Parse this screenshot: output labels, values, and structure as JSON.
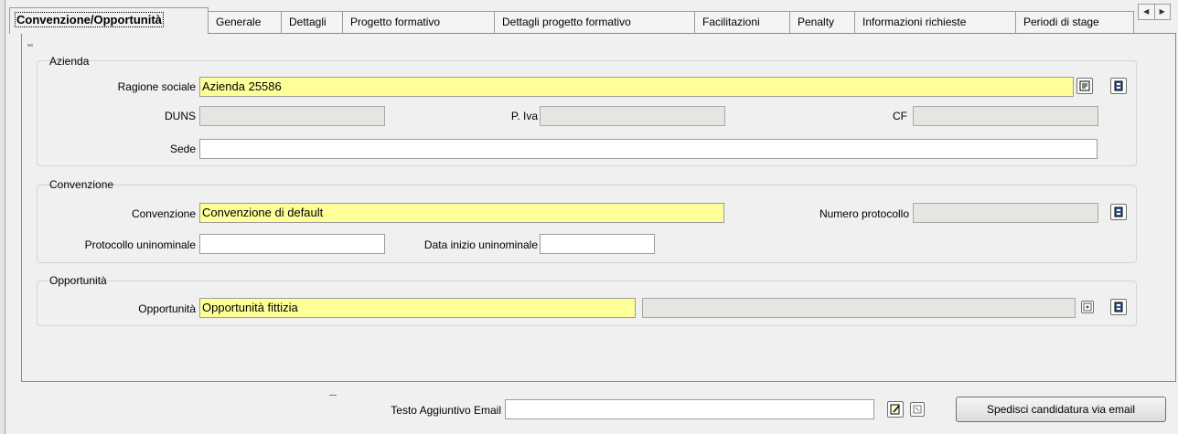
{
  "tabs": [
    {
      "label": "Convenzione/Opportunità",
      "active": true
    },
    {
      "label": "Generale"
    },
    {
      "label": "Dettagli"
    },
    {
      "label": "Progetto formativo"
    },
    {
      "label": "Dettagli progetto formativo"
    },
    {
      "label": "Facilitazioni"
    },
    {
      "label": "Penalty"
    },
    {
      "label": "Informazioni richieste"
    },
    {
      "label": "Periodi di stage"
    }
  ],
  "tab_scroll": {
    "left_icon": "arrow-left-icon",
    "right_icon": "arrow-right-icon"
  },
  "azienda": {
    "title": "Azienda",
    "ragione_sociale_label": "Ragione sociale",
    "ragione_sociale_value": "Azienda 25586",
    "duns_label": "DUNS",
    "duns_value": "",
    "piva_label": "P. Iva",
    "piva_value": "",
    "cf_label": "CF",
    "cf_value": "",
    "sede_label": "Sede",
    "sede_value": ""
  },
  "convenzione": {
    "title": "Convenzione",
    "convenzione_label": "Convenzione",
    "convenzione_value": "Convenzione di default",
    "numero_protocollo_label": "Numero protocollo",
    "numero_protocollo_value": "",
    "protocollo_uninominale_label": "Protocollo uninominale",
    "protocollo_uninominale_value": "",
    "data_inizio_label": "Data inizio uninominale",
    "data_inizio_value": ""
  },
  "opportunita": {
    "title": "Opportunità",
    "opportunita_label": "Opportunità",
    "opportunita_value": "Opportunità fittizia",
    "opportunita_desc": ""
  },
  "footer": {
    "testo_label": "Testo Aggiuntivo Email",
    "testo_value": "",
    "send_button": "Spedisci candidatura via email"
  },
  "colors": {
    "required_field": "#ffff99",
    "readonly_field": "#e6e5e1",
    "background": "#f0f0f0"
  }
}
